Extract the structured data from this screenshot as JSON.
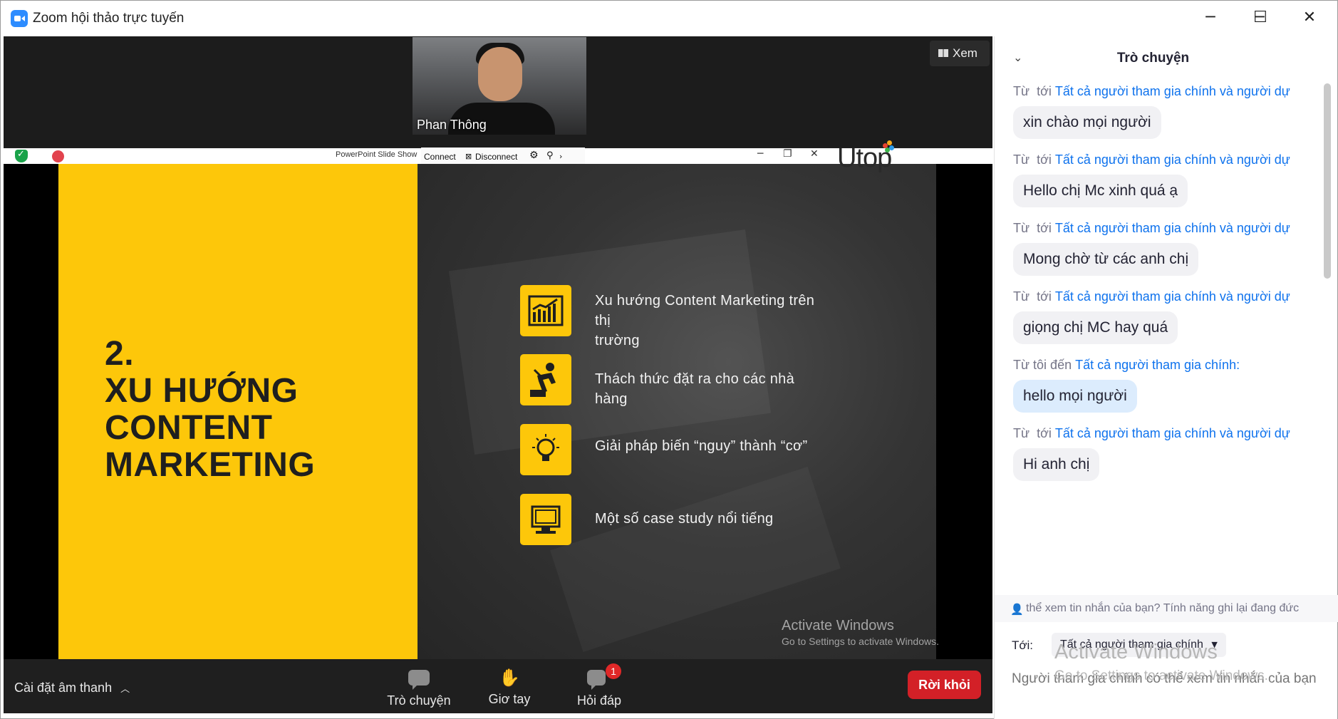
{
  "window": {
    "title": "Zoom hội thảo trực tuyến",
    "minimize_icon": "minimize-icon",
    "maximize_icon": "maximize-icon",
    "close_icon": "close-icon"
  },
  "gallery": {
    "participant_name": "Phan Thông",
    "view_button": "Xem"
  },
  "share_toolbar": {
    "app_title": "PowerPoint Slide Show",
    "connect": "Connect",
    "disconnect": "Disconnect"
  },
  "slide": {
    "heading_lines": [
      "2.",
      "XU HƯỚNG",
      "CONTENT",
      "MARKETING"
    ],
    "brand": "Utop",
    "items": [
      {
        "icon": "chart-icon",
        "lines": [
          "Xu hướng Content Marketing trên thị",
          "trường"
        ]
      },
      {
        "icon": "worker-icon",
        "lines": [
          "Thách thức đặt ra cho các nhà hàng"
        ]
      },
      {
        "icon": "lightbulb-icon",
        "lines": [
          "Giải pháp biến “nguy” thành “cơ”"
        ]
      },
      {
        "icon": "monitor-icon",
        "lines": [
          "Một số case study nổi tiếng"
        ]
      }
    ],
    "activate_title": "Activate Windows",
    "activate_sub": "Go to Settings to activate Windows."
  },
  "toolbar": {
    "audio_settings": "Cài đặt âm thanh",
    "chat": "Trò chuyện",
    "raise_hand": "Giơ tay",
    "qa": "Hỏi đáp",
    "qa_badge": "1",
    "leave": "Rời khỏi"
  },
  "chat": {
    "title": "Trò chuyện",
    "messages": [
      {
        "from": "Từ",
        "to_prefix": "tới",
        "to": "Tất cả người tham gia chính và người dự",
        "text": "xin chào mọi người",
        "self": false
      },
      {
        "from": "Từ",
        "to_prefix": "tới",
        "to": "Tất cả người tham gia chính và người dự",
        "text": "Hello chị Mc xinh quá ạ",
        "self": false
      },
      {
        "from": "Từ",
        "to_prefix": "tới",
        "to": "Tất cả người tham gia chính và người dự",
        "text": "Mong chờ từ các anh chị",
        "self": false
      },
      {
        "from": "Từ",
        "to_prefix": "tới",
        "to": "Tất cả người tham gia chính và người dự",
        "text": "giọng chị MC hay quá",
        "self": false
      },
      {
        "from": "Từ tôi đến",
        "to_prefix": "",
        "to": "Tất cả người tham gia chính:",
        "text": "hello mọi người",
        "self": true
      },
      {
        "from": "Từ",
        "to_prefix": "tới",
        "to": "Tất cả người tham gia chính và người dự",
        "text": "Hi anh chị",
        "self": false
      }
    ],
    "privacy_note": "thể xem tin nhắn của bạn? Tính năng ghi lại đang đức",
    "to_label": "Tới:",
    "to_value": "Tất cả người tham gia chính",
    "input_placeholder": "Người tham gia chính có thể xem tin nhắn của bạn",
    "activate_title": "Activate Windows",
    "activate_sub": "Go to Settings to activate Windows."
  }
}
